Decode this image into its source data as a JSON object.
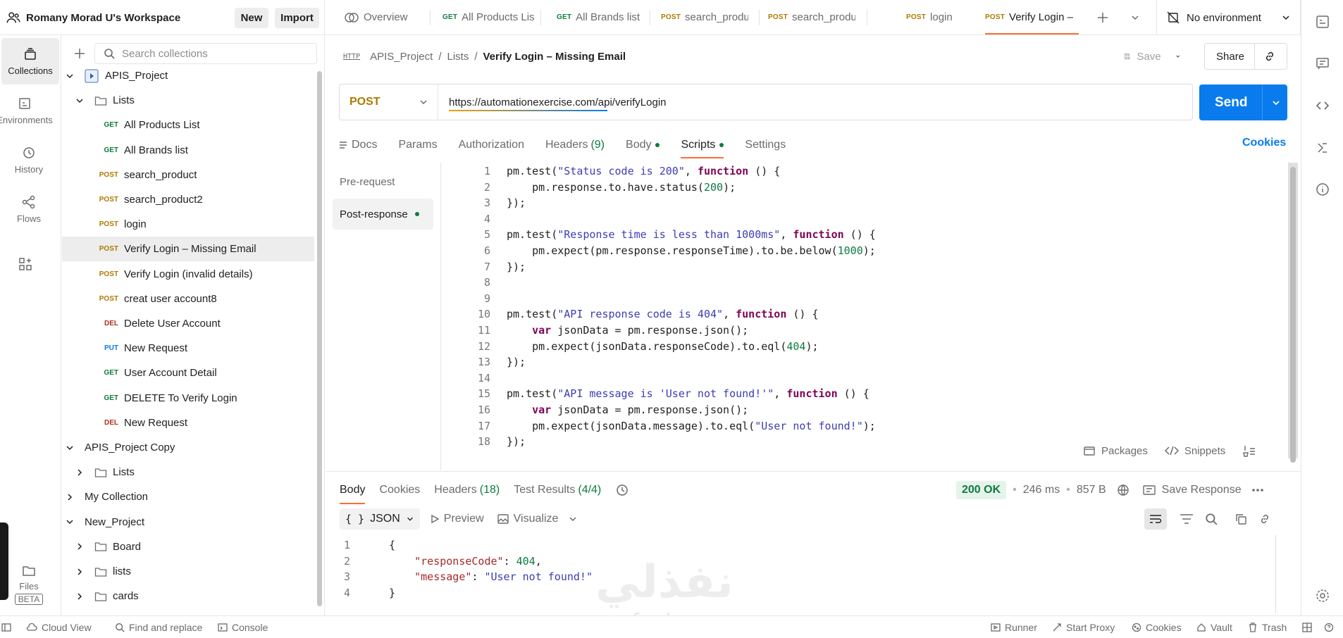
{
  "workspace": {
    "name": "Romany Morad U's Workspace",
    "new_label": "New",
    "import_label": "Import"
  },
  "tabs": [
    {
      "method": "",
      "label": "Overview"
    },
    {
      "method": "GET",
      "label": "All Products Lis"
    },
    {
      "method": "GET",
      "label": "All Brands list"
    },
    {
      "method": "POST",
      "label": "search_produ"
    },
    {
      "method": "POST",
      "label": "search_produ"
    },
    {
      "method": "POST",
      "label": "login"
    },
    {
      "method": "POST",
      "label": "Verify Login –"
    }
  ],
  "environment": {
    "label": "No environment"
  },
  "rail": {
    "collections": "Collections",
    "environments": "Environments",
    "history": "History",
    "flows": "Flows",
    "files": "Files",
    "beta": "BETA"
  },
  "sidebar": {
    "search_placeholder": "Search collections",
    "tree": [
      {
        "method": "",
        "label": "APIS_Project"
      },
      {
        "method": "",
        "label": "Lists"
      },
      {
        "method": "GET",
        "label": "All Products List"
      },
      {
        "method": "GET",
        "label": "All Brands list"
      },
      {
        "method": "POST",
        "label": "search_product"
      },
      {
        "method": "POST",
        "label": "search_product2"
      },
      {
        "method": "POST",
        "label": "login"
      },
      {
        "method": "POST",
        "label": "Verify Login – Missing Email"
      },
      {
        "method": "POST",
        "label": "Verify Login (invalid details)"
      },
      {
        "method": "POST",
        "label": "creat user account8"
      },
      {
        "method": "DEL",
        "label": "Delete User Account"
      },
      {
        "method": "PUT",
        "label": "New Request"
      },
      {
        "method": "GET",
        "label": "User Account Detail"
      },
      {
        "method": "GET",
        "label": "DELETE To Verify Login"
      },
      {
        "method": "DEL",
        "label": "New Request"
      },
      {
        "method": "",
        "label": "APIS_Project Copy"
      },
      {
        "method": "",
        "label": "Lists"
      },
      {
        "method": "",
        "label": "My Collection"
      },
      {
        "method": "",
        "label": "New_Project"
      },
      {
        "method": "",
        "label": "Board"
      },
      {
        "method": "",
        "label": "lists"
      },
      {
        "method": "",
        "label": "cards"
      }
    ]
  },
  "request": {
    "breadcrumb": [
      "APIS_Project",
      "Lists",
      "Verify Login – Missing Email"
    ],
    "http_icon": "HTTP",
    "save_label": "Save",
    "share_label": "Share",
    "method": "POST",
    "url": "https://automationexercise.com/api/verifyLogin",
    "send_label": "Send",
    "tabs": [
      "Docs",
      "Params",
      "Authorization",
      "Headers",
      "Body",
      "Scripts",
      "Settings"
    ],
    "headers_count": "(9)",
    "cookies_label": "Cookies",
    "script_nav": [
      "Pre-request",
      "Post-response"
    ],
    "packages_label": "Packages",
    "snippets_label": "Snippets"
  },
  "script_lines": [
    "pm.test(\"Status code is 200\", function () {",
    "    pm.response.to.have.status(200);",
    "});",
    "",
    "pm.test(\"Response time is less than 1000ms\", function () {",
    "    pm.expect(pm.response.responseTime).to.be.below(1000);",
    "});",
    "",
    "",
    "pm.test(\"API response code is 404\", function () {",
    "    var jsonData = pm.response.json();",
    "    pm.expect(jsonData.responseCode).to.eql(404);",
    "});",
    "",
    "pm.test(\"API message is 'User not found!'\", function () {",
    "    var jsonData = pm.response.json();",
    "    pm.expect(jsonData.message).to.eql(\"User not found!\");",
    "});"
  ],
  "response": {
    "tabs": [
      "Body",
      "Cookies",
      "Headers",
      "Test Results"
    ],
    "headers_count": "(18)",
    "test_count": "(4/4)",
    "status": "200 OK",
    "time": "246 ms",
    "size": "857 B",
    "save_response": "Save Response",
    "format": "JSON",
    "preview_label": "Preview",
    "visualize_label": "Visualize",
    "body_lines": [
      "{",
      "    \"responseCode\": 404,",
      "    \"message\": \"User not found!\"",
      "}"
    ]
  },
  "statusbar": {
    "cloud_view": "Cloud View",
    "find_replace": "Find and replace",
    "console": "Console",
    "runner": "Runner",
    "start_proxy": "Start Proxy",
    "cookies": "Cookies",
    "vault": "Vault",
    "trash": "Trash"
  },
  "watermark": {
    "arabic": "نفذلي",
    "latin": "nafezly.com"
  },
  "colors": {
    "accent": "#ff6c37",
    "send": "#097bed",
    "get": "#0f7b3e",
    "post": "#ad7a03",
    "del": "#b22f1f",
    "put": "#097bed"
  }
}
